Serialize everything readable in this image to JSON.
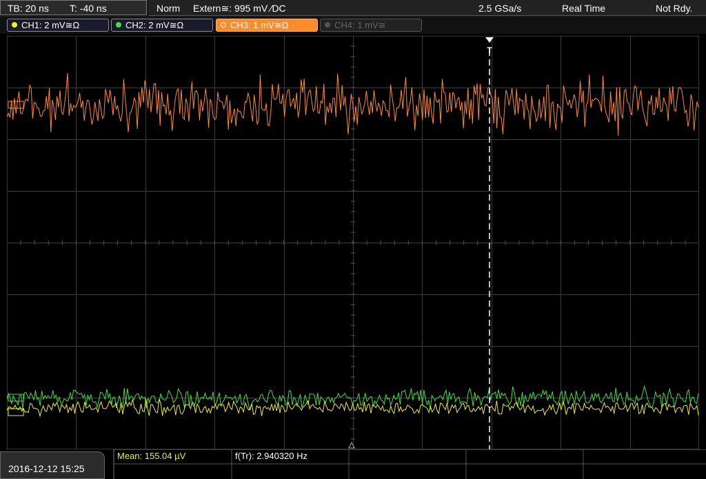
{
  "status": {
    "timebase": "TB: 20 ns",
    "trigger_time": "T: -40 ns",
    "trigger_mode": "Norm",
    "trigger_source": "Extern≅: 995 mV ⁄DC",
    "sample_rate": "2.5 GSa/s",
    "acq_mode": "Real Time",
    "state": "Not Rdy."
  },
  "channels": [
    {
      "label": "CH1: 2 mV≅Ω",
      "color": "#f0f020",
      "active": false,
      "enabled": true
    },
    {
      "label": "CH2: 2 mV≅Ω",
      "color": "#40e040",
      "active": false,
      "enabled": true
    },
    {
      "label": "CH3: 1 mV≅Ω",
      "color": "#ff8c2a",
      "active": true,
      "enabled": true
    },
    {
      "label": "CH4: 1 mV≅",
      "color": "#777777",
      "active": false,
      "enabled": false
    }
  ],
  "markers": {
    "trigger_label": "T"
  },
  "footer": {
    "date": "2016-12-12 15:25",
    "mean": "Mean: 155.04 µV",
    "freq": "f(Tr): 2.940320 Hz"
  },
  "colors": {
    "ch1": "#f0f020",
    "ch2": "#40e040",
    "ch3": "#ff8c2a",
    "grid": "#3a3a3a",
    "accent": "#ff8c2a"
  }
}
